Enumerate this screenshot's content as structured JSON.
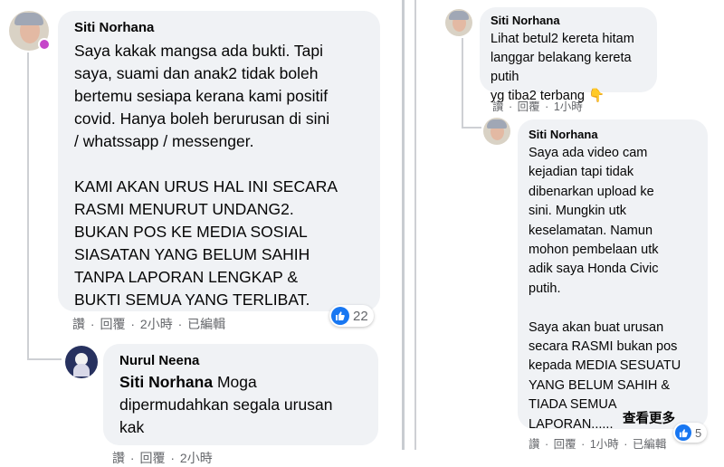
{
  "left": {
    "comment": {
      "author": "Siti Norhana",
      "text": "Saya kakak mangsa ada bukti. Tapi\nsaya, suami dan anak2 tidak boleh\nbertemu sesiapa kerana kami positif\ncovid. Hanya boleh berurusan di sini\n/ whatssapp / messenger.\n\nKAMI AKAN URUS HAL INI SECARA\nRASMI MENURUT UNDANG2.\nBUKAN POS KE MEDIA SOSIAL\nSIASATAN YANG BELUM SAHIH\nTANPA LAPORAN LENGKAP &\nBUKTI SEMUA YANG TERLIBAT.",
      "meta": {
        "like": "讚",
        "sep1": "·",
        "reply": "回覆",
        "sep2": "·",
        "time": "2小時",
        "sep3": "·",
        "edited": "已編輯"
      },
      "reaction_count": "22"
    },
    "reply": {
      "author": "Nurul Neena",
      "tag": "Siti Norhana",
      "text": " Moga\ndipermudahkan segala urusan\nkak"
    },
    "reply_meta": {
      "like": "讚",
      "sep1": "·",
      "reply": "回覆",
      "sep2": "·",
      "time": "2小時"
    }
  },
  "right": {
    "comment1": {
      "author": "Siti Norhana",
      "text": "Lihat betul2 kereta hitam\nlanggar belakang kereta putih\nyg tiba2 terbang 👇",
      "meta": {
        "like": "讚",
        "sep1": "·",
        "reply": "回覆",
        "sep2": "·",
        "time": "1小時"
      }
    },
    "comment2": {
      "author": "Siti Norhana",
      "text": "Saya ada video cam\nkejadian tapi tidak\ndibenarkan upload ke\nsini. Mungkin utk\nkeselamatan. Namun\nmohon pembelaan utk\nadik saya Honda Civic\nputih.\n\nSaya akan buat urusan\nsecara RASMI bukan pos\nkepada MEDIA SESUATU\nYANG BELUM SAHIH &\nTIADA SEMUA\nLAPORAN......",
      "see_more": "查看更多",
      "reaction_count": "5",
      "meta": {
        "like": "讚",
        "sep1": "·",
        "reply": "回覆",
        "sep2": "·",
        "time": "1小時",
        "sep3": "·",
        "edited": "已編輯"
      }
    }
  },
  "colors": {
    "bubble": "#f0f2f5",
    "like_blue": "#1877f2",
    "meta_gray": "#65676b"
  }
}
